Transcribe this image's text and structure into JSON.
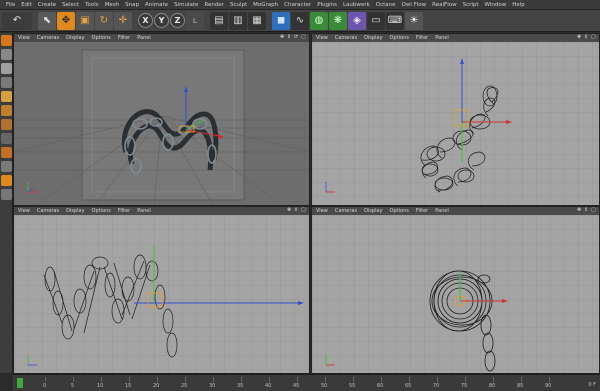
{
  "menu": [
    "File",
    "Edit",
    "Create",
    "Select",
    "Tools",
    "Mesh",
    "Snap",
    "Animate",
    "Simulate",
    "Render",
    "Sculpt",
    "MoGraph",
    "Character",
    "Plugins",
    "Laubwerk",
    "Octane",
    "Owl Flow",
    "RealFlow",
    "Script",
    "Window",
    "Help"
  ],
  "toolbar": {
    "undo": "↶",
    "select": "⬉",
    "move": "✥",
    "scale": "▣",
    "rotate": "↻",
    "transform": "✛",
    "x": "X",
    "y": "Y",
    "z": "Z",
    "coord": "L"
  },
  "viewports": {
    "top_left": {
      "menu": [
        "View",
        "Cameras",
        "Display",
        "Options",
        "Filter",
        "Panel"
      ]
    },
    "top_right": {
      "menu": [
        "View",
        "Cameras",
        "Display",
        "Options",
        "Filter",
        "Panel"
      ]
    },
    "bottom_left": {
      "menu": [
        "View",
        "Cameras",
        "Display",
        "Options",
        "Filter",
        "Panel"
      ]
    },
    "bottom_right": {
      "menu": [
        "View",
        "Cameras",
        "Display",
        "Options",
        "Filter",
        "Panel"
      ]
    }
  },
  "timeline": {
    "labels": [
      "0",
      "5",
      "10",
      "15",
      "20",
      "25",
      "30",
      "35",
      "40",
      "45",
      "50",
      "55",
      "60",
      "65",
      "70",
      "75",
      "80",
      "85",
      "90"
    ],
    "end": "0 F"
  },
  "colors": {
    "move_active": "#e08a1e",
    "axis_x": "#d23030",
    "axis_y": "#3cbf3c",
    "axis_z": "#3050d0",
    "selection": "#e8a020"
  }
}
